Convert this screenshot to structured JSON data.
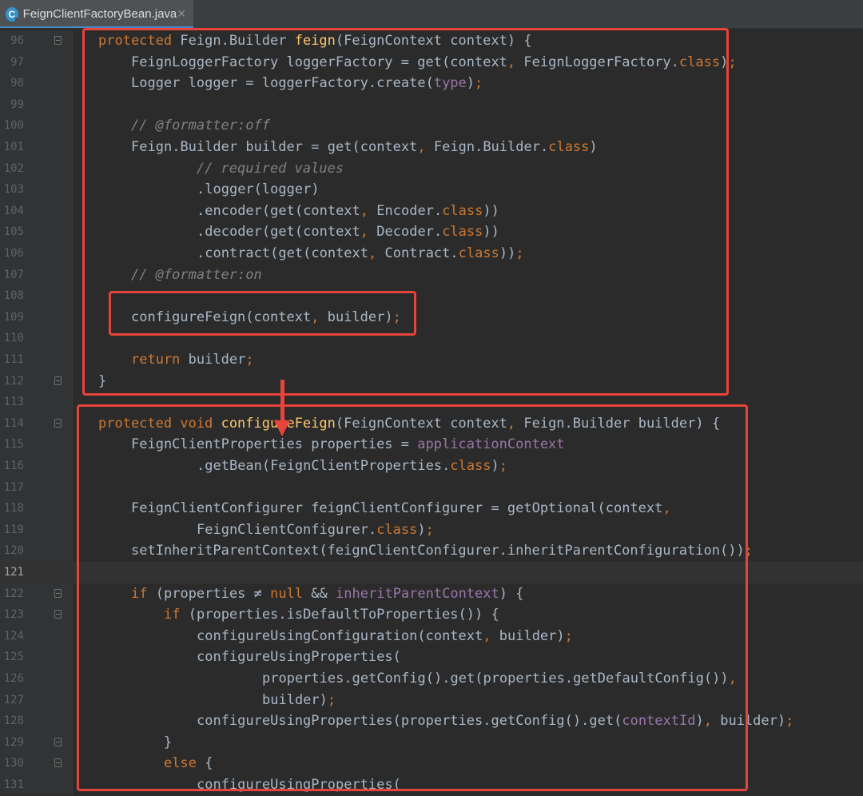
{
  "tab": {
    "filename": "FeignClientFactoryBean.java",
    "file_icon": "java-class-icon",
    "close_icon": "close-icon"
  },
  "editor": {
    "current_line": "121",
    "lines": [
      {
        "num": "96",
        "fold": true,
        "tokens": [
          [
            "kw",
            "protected"
          ],
          [
            "",
            "Feign.Builder"
          ],
          [
            "fn",
            "feign"
          ],
          [
            "",
            "(FeignContext context) {"
          ]
        ],
        "text": "protected Feign.Builder feign(FeignContext context) {"
      },
      {
        "num": "97",
        "fold": false,
        "text": "    FeignLoggerFactory loggerFactory = get(context, FeignLoggerFactory.class);"
      },
      {
        "num": "98",
        "fold": false,
        "text": "    Logger logger = loggerFactory.create(type);"
      },
      {
        "num": "99",
        "fold": false,
        "text": ""
      },
      {
        "num": "100",
        "fold": false,
        "text": "    // @formatter:off"
      },
      {
        "num": "101",
        "fold": false,
        "text": "    Feign.Builder builder = get(context, Feign.Builder.class)"
      },
      {
        "num": "102",
        "fold": false,
        "text": "            // required values"
      },
      {
        "num": "103",
        "fold": false,
        "text": "            .logger(logger)"
      },
      {
        "num": "104",
        "fold": false,
        "text": "            .encoder(get(context, Encoder.class))"
      },
      {
        "num": "105",
        "fold": false,
        "text": "            .decoder(get(context, Decoder.class))"
      },
      {
        "num": "106",
        "fold": false,
        "text": "            .contract(get(context, Contract.class));"
      },
      {
        "num": "107",
        "fold": false,
        "text": "    // @formatter:on"
      },
      {
        "num": "108",
        "fold": false,
        "text": ""
      },
      {
        "num": "109",
        "fold": false,
        "text": "    configureFeign(context, builder);"
      },
      {
        "num": "110",
        "fold": false,
        "text": ""
      },
      {
        "num": "111",
        "fold": false,
        "text": "    return builder;"
      },
      {
        "num": "112",
        "fold": true,
        "text": "}"
      },
      {
        "num": "113",
        "fold": false,
        "text": ""
      },
      {
        "num": "114",
        "fold": true,
        "text": "protected void configureFeign(FeignContext context, Feign.Builder builder) {"
      },
      {
        "num": "115",
        "fold": false,
        "text": "    FeignClientProperties properties = applicationContext"
      },
      {
        "num": "116",
        "fold": false,
        "text": "            .getBean(FeignClientProperties.class);"
      },
      {
        "num": "117",
        "fold": false,
        "text": ""
      },
      {
        "num": "118",
        "fold": false,
        "text": "    FeignClientConfigurer feignClientConfigurer = getOptional(context,"
      },
      {
        "num": "119",
        "fold": false,
        "text": "            FeignClientConfigurer.class);"
      },
      {
        "num": "120",
        "fold": false,
        "text": "    setInheritParentContext(feignClientConfigurer.inheritParentConfiguration());"
      },
      {
        "num": "121",
        "fold": false,
        "text": ""
      },
      {
        "num": "122",
        "fold": true,
        "text": "    if (properties ≠ null && inheritParentContext) {"
      },
      {
        "num": "123",
        "fold": true,
        "text": "        if (properties.isDefaultToProperties()) {"
      },
      {
        "num": "124",
        "fold": false,
        "text": "            configureUsingConfiguration(context, builder);"
      },
      {
        "num": "125",
        "fold": false,
        "text": "            configureUsingProperties("
      },
      {
        "num": "126",
        "fold": false,
        "text": "                    properties.getConfig().get(properties.getDefaultConfig()),"
      },
      {
        "num": "127",
        "fold": false,
        "text": "                    builder);"
      },
      {
        "num": "128",
        "fold": false,
        "text": "            configureUsingProperties(properties.getConfig().get(contextId), builder);"
      },
      {
        "num": "129",
        "fold": true,
        "text": "        }"
      },
      {
        "num": "130",
        "fold": true,
        "text": "        else {"
      },
      {
        "num": "131",
        "fold": false,
        "text": "            configureUsingProperties("
      }
    ]
  },
  "annotations": {
    "color": "#e8433a",
    "boxes": [
      "feign-method-highlight",
      "configure-feign-call-highlight",
      "configure-feign-method-highlight"
    ],
    "arrow": "call-to-definition-arrow"
  },
  "theme": {
    "background": "#2b2b2b",
    "gutter": "#313335",
    "keyword": "#cc7832",
    "method_decl": "#ffc66d",
    "field": "#9876aa",
    "comment": "#808080",
    "text": "#a9b7c6"
  }
}
